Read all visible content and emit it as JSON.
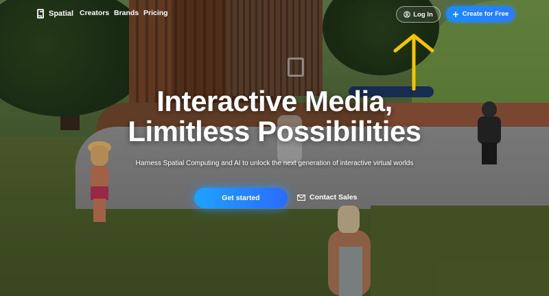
{
  "brand": {
    "name": "Spatial",
    "logo_icon": "spatial-logo-icon"
  },
  "nav": {
    "links": [
      "Creators",
      "Brands",
      "Pricing"
    ],
    "login_label": "Log In",
    "login_icon": "user-circle-icon",
    "create_label": "Create for Free",
    "create_icon": "plus-icon"
  },
  "hero": {
    "title_line1": "Interactive Media,",
    "title_line2": "Limitless Possibilities",
    "subtitle": "Harness Spatial Computing and AI to unlock the next generation of interactive virtual worlds",
    "primary_cta": "Get started",
    "secondary_cta": "Contact Sales",
    "secondary_icon": "mail-icon"
  },
  "annotation": {
    "icon": "up-arrow-icon",
    "color": "#f5c400"
  },
  "colors": {
    "accent": "#1a8cff",
    "text": "#ffffff"
  }
}
